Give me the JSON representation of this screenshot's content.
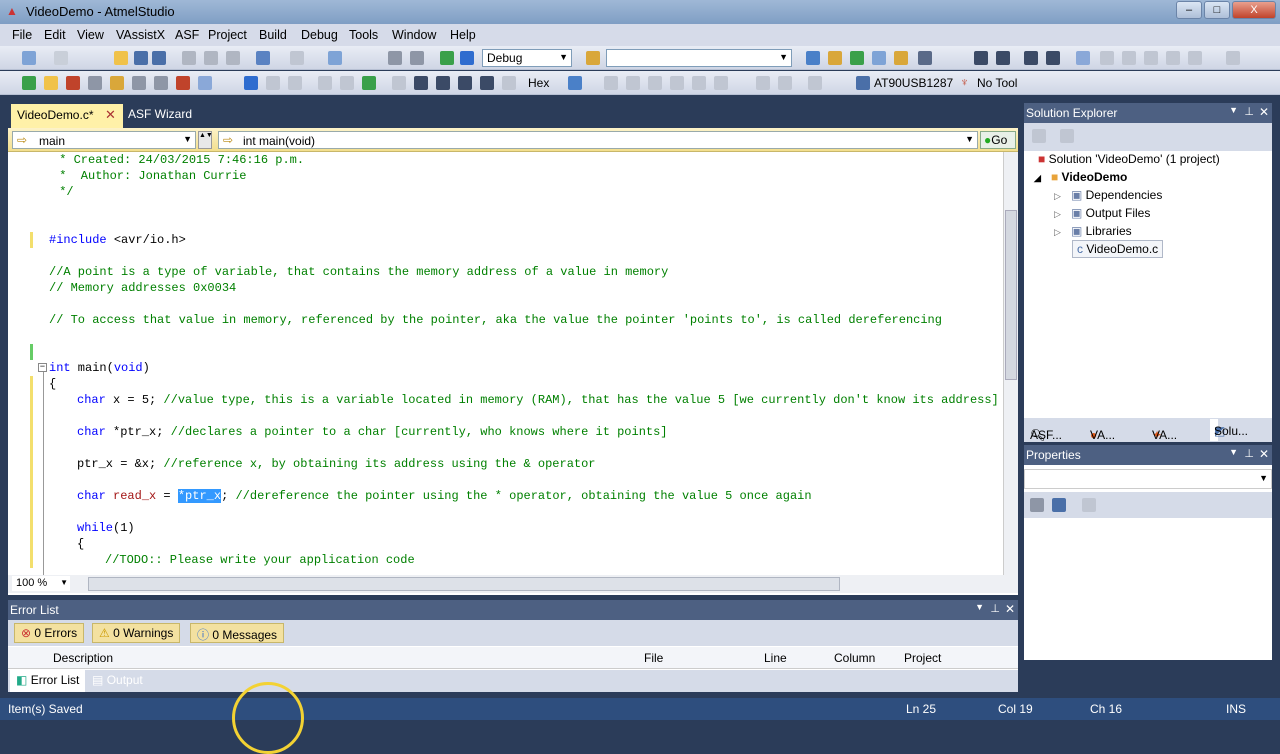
{
  "window": {
    "title": "VideoDemo - AtmelStudio",
    "min": "–",
    "max": "□",
    "close": "X"
  },
  "menu": [
    "File",
    "Edit",
    "View",
    "VAssistX",
    "ASF",
    "Project",
    "Build",
    "Debug",
    "Tools",
    "Window",
    "Help"
  ],
  "toolbar": {
    "config": "Debug",
    "hex_label": "Hex",
    "device": "AT90USB1287",
    "tool": "No Tool"
  },
  "tabs": {
    "active": "VideoDemo.c*",
    "inactive": "ASF Wizard"
  },
  "navbar": {
    "scope": "main",
    "function": "int main(void)",
    "go": "Go"
  },
  "code": {
    "l1": " * Created: 24/03/2015 7:46:16 p.m.",
    "l2": " *  Author: Jonathan Currie",
    "l3": " */",
    "l4a": "#include ",
    "l4b": "<avr/io.h>",
    "l5": "//A point is a type of variable, that contains the memory address of a value in memory",
    "l6": "// Memory addresses 0x0034",
    "l7": "// To access that value in memory, referenced by the pointer, aka the value the pointer 'points to', is called dereferencing",
    "l8a": "int",
    "l8b": " main(",
    "l8c": "void",
    "l8d": ")",
    "l9": "{",
    "l10a": "char",
    "l10b": " x = 5; ",
    "l10c": "//value type, this is a variable located in memory (RAM), that has the value 5 [we currently don't know its address]",
    "l11a": "char",
    "l11b": " *ptr_x; ",
    "l11c": "//declares a pointer to a char [currently, who knows where it points]",
    "l12a": "ptr_x = &x; ",
    "l12b": "//reference x, by obtaining its address using the & operator",
    "l13a": "char",
    "l13b": "read_x",
    "l13c": " = ",
    "l13d": "*ptr_x",
    "l13e": "; ",
    "l13f": "//dereference the pointer using the * operator, obtaining the value 5 once again",
    "l14a": "while",
    "l14b": "(1)",
    "l15": "{",
    "l16": "//TODO:: Please write your application code"
  },
  "zoom": "100 %",
  "solution": {
    "title": "Solution Explorer",
    "root": "Solution 'VideoDemo' (1 project)",
    "project": "VideoDemo",
    "items": [
      "Dependencies",
      "Output Files",
      "Libraries",
      "VideoDemo.c"
    ],
    "tabs": [
      "ASF...",
      "VA...",
      "VA...",
      "Solu..."
    ]
  },
  "properties": {
    "title": "Properties"
  },
  "errors": {
    "title": "Error List",
    "errors": "0 Errors",
    "warnings": "0 Warnings",
    "messages": "0 Messages",
    "columns": [
      "Description",
      "File",
      "Line",
      "Column",
      "Project"
    ],
    "bottom_tabs": [
      "Error List",
      "Output"
    ]
  },
  "status": {
    "left": "Item(s) Saved",
    "ln": "Ln 25",
    "col": "Col 19",
    "ch": "Ch 16",
    "mode": "INS"
  }
}
